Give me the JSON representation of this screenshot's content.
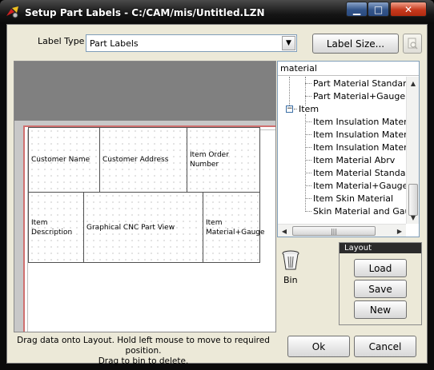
{
  "window": {
    "title": "Setup Part Labels - C:/CAM/mis/Untitled.LZN",
    "minimize_glyph": "▁",
    "maximize_glyph": "□",
    "close_glyph": "✕"
  },
  "label_type": {
    "label": "Label Type",
    "selected": "Part Labels"
  },
  "buttons": {
    "label_size": "Label Size...",
    "ok": "Ok",
    "cancel": "Cancel"
  },
  "layout_cells": [
    "Customer Name",
    "Customer Address",
    "Item Order Number",
    "Item Description",
    "Graphical CNC Part View",
    "Item Material+Gauge"
  ],
  "tree": {
    "header": "material",
    "items": [
      "Part Material Standard",
      "Part Material+Gauge",
      "Item",
      "Item Insulation Material",
      "Item Insulation Material Abrv",
      "Item Insulation Material+Gauge",
      "Item Material Abrv",
      "Item Material Standard",
      "Item Material+Gauge",
      "Item Skin Material",
      "Skin Material and Gauge"
    ]
  },
  "bin": {
    "label": "Bin"
  },
  "layout_group": {
    "title": "Layout",
    "load": "Load",
    "save": "Save",
    "new": "New"
  },
  "hint": {
    "line1": "Drag data onto Layout. Hold left mouse to move to required position.",
    "line2": "Drag to bin to delete."
  }
}
